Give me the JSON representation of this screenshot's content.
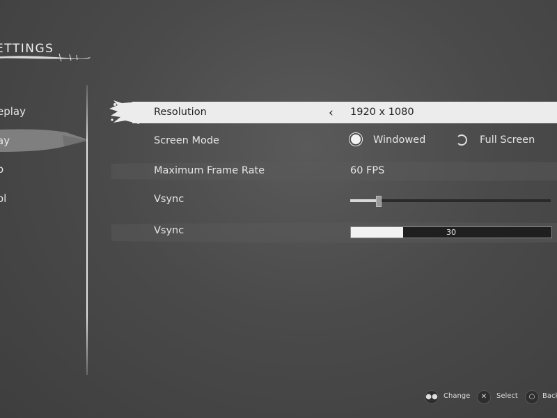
{
  "header": {
    "title": "ETTINGS"
  },
  "sidebar": {
    "items": [
      {
        "label": "eplay",
        "active": false
      },
      {
        "label": "ay",
        "active": true
      },
      {
        "label": "o",
        "active": false
      },
      {
        "label": "ol",
        "active": false
      }
    ]
  },
  "settings": {
    "resolution": {
      "label": "Resolution",
      "value": "1920 x 1080"
    },
    "screen_mode": {
      "label": "Screen Mode",
      "options": [
        "Windowed",
        "Full Screen"
      ],
      "selected": "Windowed"
    },
    "max_frame_rate": {
      "label": "Maximum Frame Rate",
      "value": "60 FPS"
    },
    "vsync_slider": {
      "label": "Vsync",
      "level_fraction": 0.14
    },
    "vsync_bar": {
      "label": "Vsync",
      "value": "30",
      "fill_fraction": 0.26
    }
  },
  "legend": {
    "change": "Change",
    "select": "Select",
    "back": "Back"
  },
  "icons": {
    "change": "dpad-icon",
    "select": "cross-button-icon",
    "back": "circle-button-icon",
    "previous": "chevron-left-icon"
  },
  "colors": {
    "selected_row": "#ececec",
    "text": "#e6e6e6",
    "dark_text": "#222222"
  }
}
